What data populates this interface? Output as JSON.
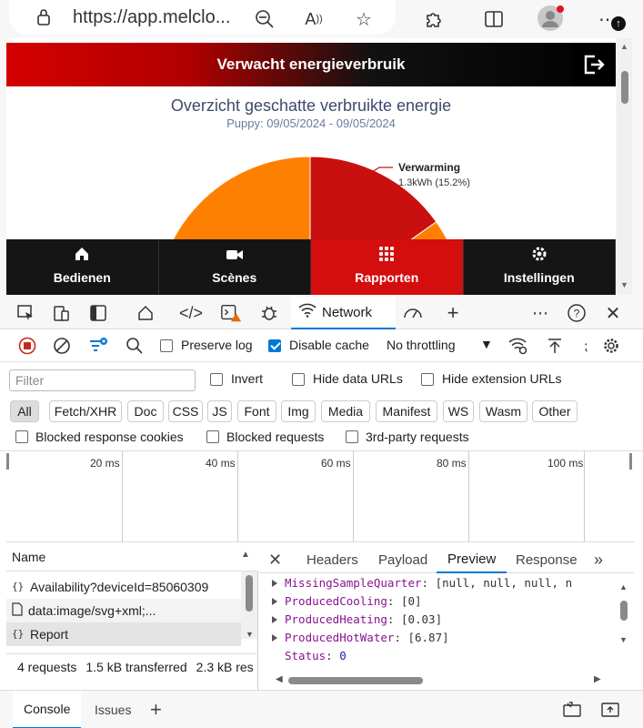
{
  "browser": {
    "url": "https://app.melclo..."
  },
  "app": {
    "header_title": "Verwacht energieverbruik",
    "chart_title": "Overzicht geschatte verbruikte energie",
    "chart_subtitle": "Puppy: 09/05/2024 - 09/05/2024",
    "nav": [
      {
        "label": "Bedienen",
        "icon": "home-icon"
      },
      {
        "label": "Scènes",
        "icon": "camera-icon"
      },
      {
        "label": "Rapporten",
        "icon": "grid-icon",
        "active": true
      },
      {
        "label": "Instellingen",
        "icon": "gear-icon"
      }
    ],
    "colors": {
      "brand_red": "#d40d0d",
      "slice_orange": "#ff8000",
      "slice_red": "#c91010"
    }
  },
  "chart_data": {
    "type": "pie",
    "title": "Overzicht geschatte verbruikte energie",
    "subtitle": "Puppy: 09/05/2024 - 09/05/2024",
    "series": [
      {
        "name": "Verwarming",
        "value_label": "1.3kWh (15.2%)",
        "percent": 15.2
      }
    ],
    "label_name": "Verwarming",
    "label_value": "1.3kWh (15.2%)"
  },
  "devtools": {
    "network_tab": "Network",
    "toolbar": {
      "preserve_log": "Preserve log",
      "disable_cache": "Disable cache",
      "throttling": "No throttling"
    },
    "filter": {
      "placeholder": "Filter",
      "invert": "Invert",
      "hide_data_urls": "Hide data URLs",
      "hide_extension_urls": "Hide extension URLs"
    },
    "types": [
      "All",
      "Fetch/XHR",
      "Doc",
      "CSS",
      "JS",
      "Font",
      "Img",
      "Media",
      "Manifest",
      "WS",
      "Wasm",
      "Other"
    ],
    "blocked": {
      "response_cookies": "Blocked response cookies",
      "requests": "Blocked requests",
      "third_party": "3rd-party requests"
    },
    "timeline_ticks": [
      "20 ms",
      "40 ms",
      "60 ms",
      "80 ms",
      "100 ms"
    ],
    "name_header": "Name",
    "requests": [
      {
        "name": "Availability?deviceId=85060309"
      },
      {
        "name": "data:image/svg+xml;..."
      },
      {
        "name": "Report"
      }
    ],
    "summary": {
      "requests": "4 requests",
      "transferred": "1.5 kB transferred",
      "resources": "2.3 kB res"
    },
    "detail_tabs": [
      "Headers",
      "Payload",
      "Preview",
      "Response"
    ],
    "preview_lines": [
      {
        "key": "MissingSampleQuarter",
        "value": "[null, null, null, n"
      },
      {
        "key": "ProducedCooling",
        "value": "[0]"
      },
      {
        "key": "ProducedHeating",
        "value": "[0.03]"
      },
      {
        "key": "ProducedHotWater",
        "value": "[6.87]"
      },
      {
        "key": "Status",
        "value": "0"
      }
    ],
    "drawer_tabs": [
      "Console",
      "Issues"
    ]
  }
}
